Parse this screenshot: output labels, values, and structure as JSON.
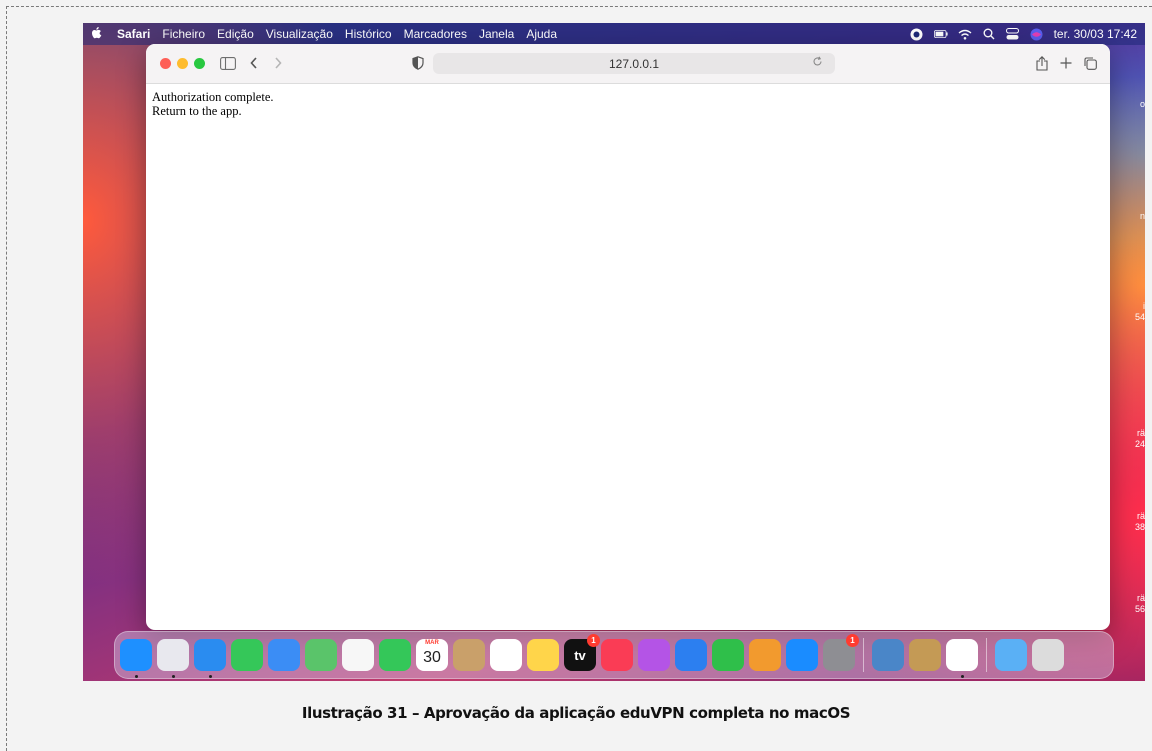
{
  "menubar": {
    "app_name": "Safari",
    "items": [
      "Ficheiro",
      "Edição",
      "Visualização",
      "Histórico",
      "Marcadores",
      "Janela",
      "Ajuda"
    ],
    "clock": "ter. 30/03  17:42",
    "status_icons": [
      "eduvpn-icon",
      "battery-icon",
      "wifi-icon",
      "search-icon",
      "control-center-icon",
      "siri-icon"
    ]
  },
  "widget_edge": [
    "o",
    "n",
    "i\n54",
    "rä\n24",
    "rä\n38",
    "rä\n56"
  ],
  "browser": {
    "url": "127.0.0.1",
    "page_lines": [
      "Authorization complete.",
      "Return to the app."
    ]
  },
  "dock": {
    "apps": [
      {
        "name": "finder-icon",
        "color": "#1e90ff",
        "running": true
      },
      {
        "name": "launchpad-icon",
        "color": "#e8e8ee",
        "running": true
      },
      {
        "name": "safari-icon",
        "color": "#2a8cf0",
        "running": true
      },
      {
        "name": "messages-icon",
        "color": "#35c759"
      },
      {
        "name": "mail-icon",
        "color": "#3b8df5"
      },
      {
        "name": "maps-icon",
        "color": "#5ac46a"
      },
      {
        "name": "photos-icon",
        "color": "#f7f7f7"
      },
      {
        "name": "facetime-icon",
        "color": "#34c759"
      },
      {
        "name": "calendar-icon",
        "color": "#ffffff",
        "month": "MAR",
        "day": "30"
      },
      {
        "name": "contacts-icon",
        "color": "#c9a06a"
      },
      {
        "name": "reminders-icon",
        "color": "#ffffff"
      },
      {
        "name": "notes-icon",
        "color": "#ffd54a"
      },
      {
        "name": "apple-tv-icon",
        "color": "#111111",
        "label": "tv",
        "badge": "1"
      },
      {
        "name": "music-icon",
        "color": "#fa3c55"
      },
      {
        "name": "podcasts-icon",
        "color": "#b454e6"
      },
      {
        "name": "keynote-icon",
        "color": "#2c7ff0"
      },
      {
        "name": "numbers-icon",
        "color": "#2fbf4a"
      },
      {
        "name": "pages-icon",
        "color": "#f29a2e"
      },
      {
        "name": "app-store-icon",
        "color": "#1a8cff"
      },
      {
        "name": "system-preferences-icon",
        "color": "#8e8e93",
        "badge": "1"
      }
    ],
    "extras": [
      {
        "name": "preview-icon",
        "color": "#4a86c8"
      },
      {
        "name": "archive-utility-icon",
        "color": "#c49a55"
      },
      {
        "name": "eduvpn-app-icon",
        "color": "#ffffff",
        "running": true
      }
    ],
    "stack": [
      {
        "name": "downloads-folder-icon",
        "color": "#5ab0f5"
      },
      {
        "name": "trash-icon",
        "color": "#dcdcdc"
      }
    ]
  },
  "caption": "Ilustração 31 – Aprovação da aplicação eduVPN completa no macOS"
}
